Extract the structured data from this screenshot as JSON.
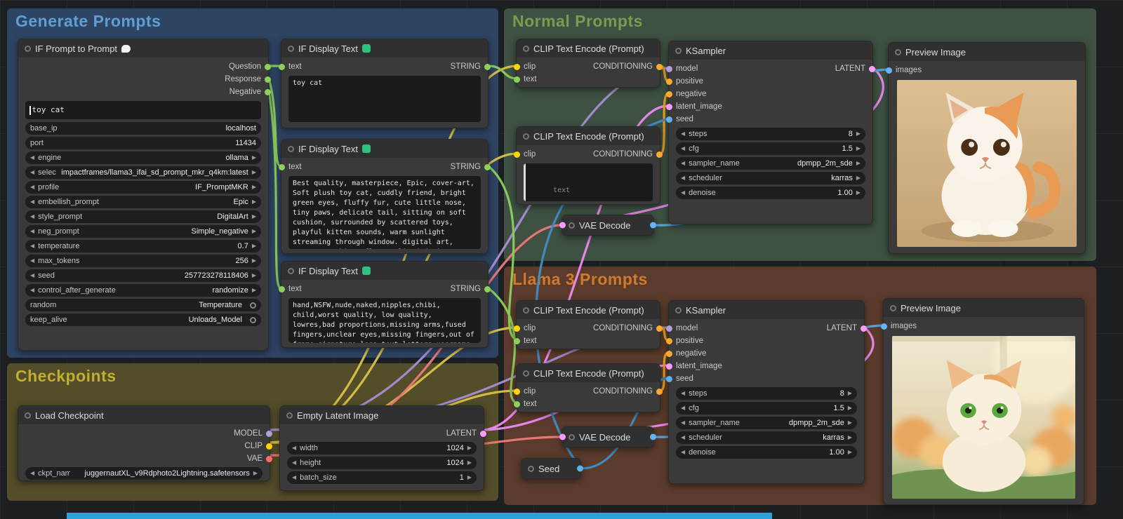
{
  "canvas": {
    "bottom_bar_color": "#2ba3d8"
  },
  "slot_colors": {
    "model": "#b39ddb",
    "clip": "#ffd500",
    "vae": "#ff6e6e",
    "conditioning": "#ffa931",
    "latent": "#ff9cf9",
    "image": "#64b5f6",
    "string": "#8ed05c",
    "int": "#5fb2e8"
  },
  "groups": {
    "generate_prompts": {
      "title": "Generate Prompts",
      "color": "#5e9fd6"
    },
    "normal_prompts": {
      "title": "Normal Prompts",
      "color": "#7d9a4e"
    },
    "llama3_prompts": {
      "title": "Llama 3 Prompts",
      "color": "#d07a2e"
    },
    "checkpoints": {
      "title": "Checkpoints",
      "color": "#c2ae31"
    }
  },
  "nodes": {
    "if_prompt": {
      "title": "IF Prompt to Prompt",
      "title_emoji": "💬",
      "outputs": [
        {
          "label": "Question"
        },
        {
          "label": "Response"
        },
        {
          "label": "Negative"
        }
      ],
      "input_text": "toy cat",
      "widgets": [
        {
          "label": "base_ip",
          "value": "localhost"
        },
        {
          "label": "port",
          "value": "11434"
        },
        {
          "label": "engine",
          "value": "ollama"
        },
        {
          "label": "selected_model",
          "value": "impactframes/llama3_ifai_sd_prompt_mkr_q4km:latest"
        },
        {
          "label": "profile",
          "value": "IF_PromptMKR"
        },
        {
          "label": "embellish_prompt",
          "value": "Epic"
        },
        {
          "label": "style_prompt",
          "value": "DigitalArt"
        },
        {
          "label": "neg_prompt",
          "value": "Simple_negative"
        },
        {
          "label": "temperature",
          "value": "0.7"
        },
        {
          "label": "max_tokens",
          "value": "256"
        },
        {
          "label": "seed",
          "value": "257723278118406"
        },
        {
          "label": "control_after_generate",
          "value": "randomize"
        },
        {
          "label": "random",
          "value": "Temperature"
        },
        {
          "label": "keep_alive",
          "value": "Unloads_Model"
        }
      ]
    },
    "display_1": {
      "title": "IF Display Text",
      "title_emoji": "🔤",
      "input_label": "text",
      "output_label": "STRING",
      "text": "toy cat"
    },
    "display_2": {
      "title": "IF Display Text",
      "title_emoji": "🔤",
      "input_label": "text",
      "output_label": "STRING",
      "text": "Best quality, masterpiece, Epic, cover-art, Soft plush toy cat, cuddly friend, bright green eyes, fluffy fur, cute little nose, tiny paws, delicate tail, sitting on soft cushion, surrounded by scattered toys, playful kitten sounds, warm sunlight streaming through window. digital art, vector graphics, flat stylized design"
    },
    "display_3": {
      "title": "IF Display Text",
      "title_emoji": "🔤",
      "input_label": "text",
      "output_label": "STRING",
      "text": "hand,NSFW,nude,naked,nipples,chibi, child,worst quality, low quality, lowres,bad proportions,missing arms,fused fingers,unclear eyes,missing fingers,out of frame,signature,logo,text,letters,username"
    },
    "clip_normal_pos": {
      "title": "CLIP Text Encode (Prompt)",
      "clip_label": "clip",
      "text_label": "text",
      "output_label": "CONDITIONING"
    },
    "clip_normal_neg": {
      "title": "CLIP Text Encode (Prompt)",
      "clip_label": "clip",
      "output_label": "CONDITIONING",
      "textarea_placeholder": "text"
    },
    "ksampler_normal": {
      "title": "KSampler",
      "inputs": [
        {
          "label": "model"
        },
        {
          "label": "positive"
        },
        {
          "label": "negative"
        },
        {
          "label": "latent_image"
        },
        {
          "label": "seed"
        }
      ],
      "output_label": "LATENT",
      "widgets": [
        {
          "label": "steps",
          "value": "8"
        },
        {
          "label": "cfg",
          "value": "1.5"
        },
        {
          "label": "sampler_name",
          "value": "dpmpp_2m_sde"
        },
        {
          "label": "scheduler",
          "value": "karras"
        },
        {
          "label": "denoise",
          "value": "1.00"
        }
      ]
    },
    "preview_normal": {
      "title": "Preview Image",
      "input_label": "images"
    },
    "vae_decode_normal": {
      "title": "VAE Decode"
    },
    "clip_llama_pos": {
      "title": "CLIP Text Encode (Prompt)",
      "clip_label": "clip",
      "text_label": "text",
      "output_label": "CONDITIONING"
    },
    "clip_llama_neg": {
      "title": "CLIP Text Encode (Prompt)",
      "clip_label": "clip",
      "text_label": "text",
      "output_label": "CONDITIONING"
    },
    "ksampler_llama": {
      "title": "KSampler",
      "inputs": [
        {
          "label": "model"
        },
        {
          "label": "positive"
        },
        {
          "label": "negative"
        },
        {
          "label": "latent_image"
        },
        {
          "label": "seed"
        }
      ],
      "output_label": "LATENT",
      "widgets": [
        {
          "label": "steps",
          "value": "8"
        },
        {
          "label": "cfg",
          "value": "1.5"
        },
        {
          "label": "sampler_name",
          "value": "dpmpp_2m_sde"
        },
        {
          "label": "scheduler",
          "value": "karras"
        },
        {
          "label": "denoise",
          "value": "1.00"
        }
      ]
    },
    "preview_llama": {
      "title": "Preview Image",
      "input_label": "images"
    },
    "vae_decode_llama": {
      "title": "VAE Decode"
    },
    "seed_node": {
      "title": "Seed"
    },
    "load_checkpoint": {
      "title": "Load Checkpoint",
      "outputs": [
        {
          "label": "MODEL"
        },
        {
          "label": "CLIP"
        },
        {
          "label": "VAE"
        }
      ],
      "widgets": [
        {
          "label": "ckpt_name",
          "value": "juggernautXL_v9Rdphoto2Lightning.safetensors"
        }
      ]
    },
    "empty_latent": {
      "title": "Empty Latent Image",
      "output_label": "LATENT",
      "widgets": [
        {
          "label": "width",
          "value": "1024"
        },
        {
          "label": "height",
          "value": "1024"
        },
        {
          "label": "batch_size",
          "value": "1"
        }
      ]
    }
  }
}
